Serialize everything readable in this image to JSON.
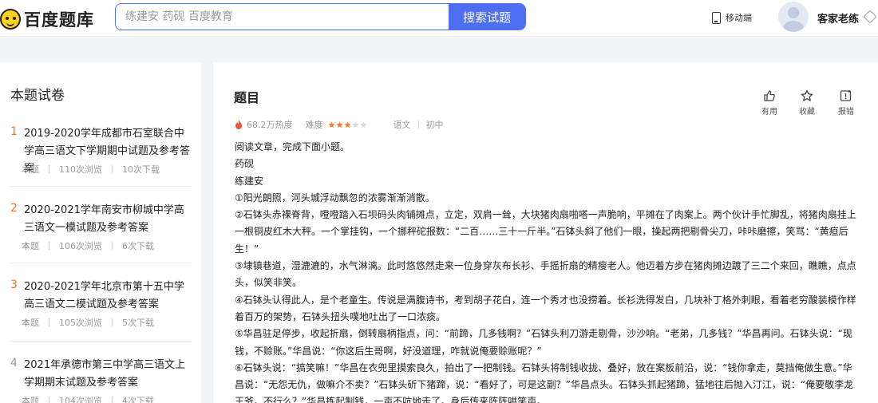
{
  "header": {
    "logo_text": "百度题库",
    "search_placeholder": "练建安 药砚 百度教育",
    "search_button": "搜索试题",
    "mobile_label": "移动端",
    "username": "客家老练"
  },
  "sidebar": {
    "title": "本题试卷",
    "items": [
      {
        "num": "1",
        "title": "2019-2020学年成都市石室联合中学高三语文下学期期中试题及参考答案",
        "tag": "本题",
        "views": "110次浏览",
        "downloads": "10次下载"
      },
      {
        "num": "2",
        "title": "2020-2021学年南安市柳城中学高三语文一模试题及参考答案",
        "tag": "本题",
        "views": "106次浏览",
        "downloads": "6次下载"
      },
      {
        "num": "3",
        "title": "2020-2021学年北京市第十五中学高三语文二模试题及参考答案",
        "tag": "本题",
        "views": "105次浏览",
        "downloads": "5次下载"
      },
      {
        "num": "4",
        "title": "2021年承德市第三中学高三语文上学期期末试题及参考答案",
        "tag": "本题",
        "views": "104次浏览",
        "downloads": "4次下载"
      }
    ]
  },
  "question": {
    "title": "题目",
    "actions": {
      "like": "有用",
      "favorite": "收藏",
      "report": "报错"
    },
    "heat": "68.2万热度",
    "difficulty_label": "难度",
    "difficulty_stars": 3,
    "difficulty_max": 5,
    "subject": "语文",
    "level": "初中",
    "star_on_color": "#ff7a2e",
    "star_off_color": "#d9d9d9",
    "lines": [
      "阅读文章，完成下面小题。",
      "药砚",
      "练建安",
      "①阳光朗照，河头城浮动飘忽的浓雾渐渐消散。",
      "②石钵头赤裸脊背，噔噔踏入石坝码头肉铺摊点，立定，双肩一耸，大块猪肉扇啪嗒一声脆响，平摊在了肉案上。两个伙计手忙脚乱，将猪肉扇挂上一根铜皮红木大秤。一个掌挂钩，一个挪秤砣报数：“二百……三十一斤半。”石钵头斜了他们一眼，操起两把剔骨尖刀，咔咔磨擦，笑骂：“黄疸后生！”",
      "③埭镇巷道，湿漉漉的，水气淋漓。此时悠悠然走来一位身穿灰布长衫、手摇折扇的精瘦老人。他迈着方步在猪肉摊边踱了三二个来回，瞧瞧，点点头，似笑非笑。",
      "④石钵头认得此人，是个老童生。传说是满腹诗书，考到胡子花白，连一个秀才也没捞着。长衫洗得发白，几块补丁格外刺眼，看着老穷酸装模作样着百万的架势，石钵头扭头噗地吐出了一口浓痰。",
      "⑤华昌驻足停步，收起折扇，倒转扇柄指点，问：“前蹄，几多钱啊？”石钵头利刀游走剔骨，沙沙响。“老弟，几多钱？”华昌再问。石钵头说：“现钱，不赊账。”华昌说：“你这后生哥啊，好没道理，咋就说俺要赊账呢？”",
      "⑥石钵头说：“搞笑嘛！”华昌在衣兜里摸索良久，拍出了一把制钱。石钵头将制钱收拢、叠好，放在案板前沿，说：“钱你拿走，莫挡俺做生意。”华昌说：“无怨无仇，做嘛介不卖？”石钵头斫下猪蹄，说：“看好了，可是这副？”华昌点头。石钵头抓起猪蹄，猛地往后抛入汀江，说：“俺要敬李龙王爷。不行么？”华昌拣起制钱，一声不吭地走了。身后传来阵阵哄笑声。"
    ]
  }
}
